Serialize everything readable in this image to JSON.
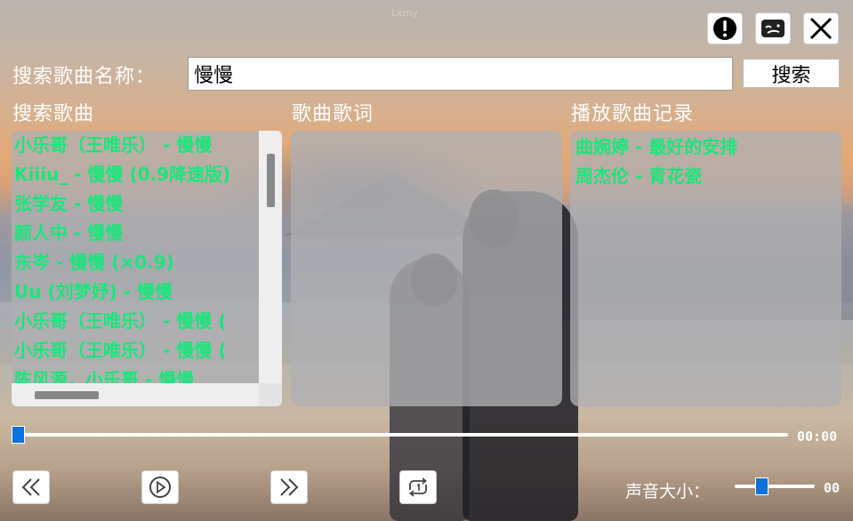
{
  "window": {
    "faint_title": "Lxmy"
  },
  "search": {
    "label": "搜索歌曲名称：",
    "value": "慢慢",
    "button_label": "搜索"
  },
  "sections": {
    "songs_title": "搜索歌曲",
    "lyrics_title": "歌曲歌词",
    "history_title": "播放歌曲记录"
  },
  "song_results": [
    "小乐哥（王唯乐） - 慢慢",
    "Kiiiu_ - 慢慢 (0.9降速版)",
    "张学友 - 慢慢",
    "颜人中 - 慢慢",
    "东岑 - 慢慢 (×0.9)",
    "Uu (刘梦妤) - 慢慢",
    "小乐哥（王唯乐） - 慢慢 (",
    "小乐哥（王唯乐） - 慢慢 (",
    "陈风源，小乐哥 - 慢慢"
  ],
  "history": [
    "曲婉婷 - 最好的安排",
    "周杰伦 - 青花瓷"
  ],
  "player": {
    "time": "00:00",
    "progress": 0,
    "volume_label": "声音大小：",
    "volume_value": "00",
    "volume_level": 0.3
  },
  "icons": {
    "info": "info-icon",
    "skin": "skin-icon",
    "close": "close-icon",
    "prev": "double-chevron-left-icon",
    "play": "play-circle-icon",
    "next": "double-chevron-right-icon",
    "loop": "loop-icon"
  },
  "colors": {
    "song_text": "#19e67a",
    "accent": "#0a72d8"
  }
}
